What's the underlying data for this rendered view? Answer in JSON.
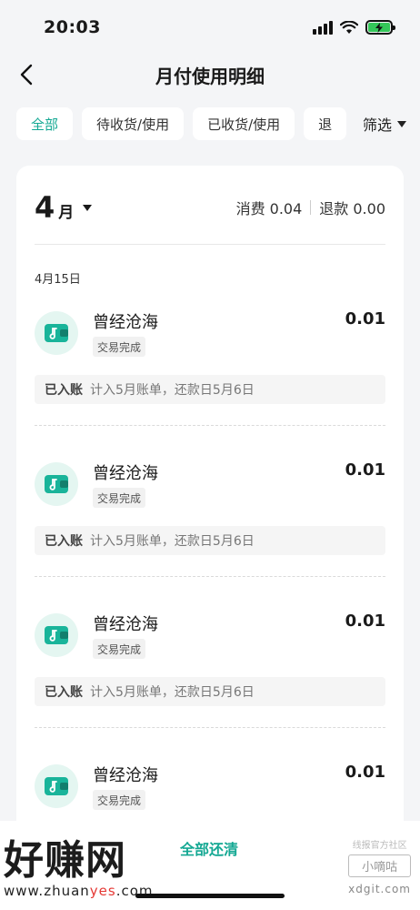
{
  "status_bar": {
    "time": "20:03"
  },
  "nav": {
    "title": "月付使用明细"
  },
  "filters": {
    "chips": [
      "全部",
      "待收货/使用",
      "已收货/使用",
      "退"
    ],
    "active_index": 0,
    "filter_label": "筛选"
  },
  "summary": {
    "month_num": "4",
    "month_unit": "月",
    "spend": "消费 0.04",
    "refund": "退款 0.00"
  },
  "date_label": "4月15日",
  "transactions": [
    {
      "name": "曾经沧海",
      "amount": "0.01",
      "status": "交易完成",
      "tag": "已入账",
      "note": "计入5月账单，还款日5月6日"
    },
    {
      "name": "曾经沧海",
      "amount": "0.01",
      "status": "交易完成",
      "tag": "已入账",
      "note": "计入5月账单，还款日5月6日"
    },
    {
      "name": "曾经沧海",
      "amount": "0.01",
      "status": "交易完成",
      "tag": "已入账",
      "note": "计入5月账单，还款日5月6日"
    },
    {
      "name": "曾经沧海",
      "amount": "0.01",
      "status": "交易完成",
      "tag": "",
      "note": ""
    }
  ],
  "bottom": {
    "repay_label": "全部还清"
  },
  "watermark": {
    "big_text": "好赚网",
    "url_prefix": "www.zhuan",
    "url_highlight": "yes",
    "url_suffix": ".com",
    "right_small": "线报官方社区",
    "right_box": "小嘀咕",
    "right_domain": "xdgit.com"
  },
  "colors": {
    "accent": "#14a893",
    "icon_bg": "#e4f6f1",
    "battery": "#34c759"
  },
  "icons": {
    "tx_icon": "wallet-music-icon",
    "back": "chevron-left-icon"
  }
}
